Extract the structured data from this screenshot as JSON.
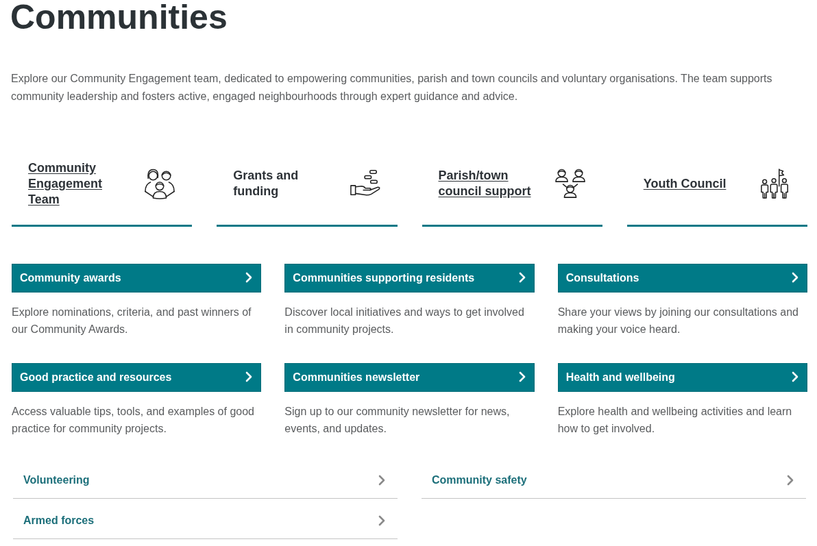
{
  "title": "Communities",
  "intro": "Explore our Community Engagement team, dedicated to empowering communities, parish and town councils and voluntary organisations. The team supports community leadership and fosters active, engaged neighbourhoods through expert guidance and advice.",
  "feature_cards": [
    {
      "title": "Community Engagement Team",
      "underlined": true
    },
    {
      "title": "Grants and funding",
      "underlined": false
    },
    {
      "title": "Parish/town council support",
      "underlined": true
    },
    {
      "title": "Youth Council",
      "underlined": true
    }
  ],
  "sections": [
    {
      "label": "Community awards",
      "description": "Explore nominations, criteria, and past winners of our Community Awards."
    },
    {
      "label": "Communities supporting residents",
      "description": "Discover local initiatives and ways to get involved in community projects."
    },
    {
      "label": "Consultations",
      "description": "Share your views by joining our consultations and making your voice heard."
    },
    {
      "label": "Good practice and resources",
      "description": "Access valuable tips, tools, and examples of good practice for community projects."
    },
    {
      "label": "Communities newsletter",
      "description": "Sign up to our community newsletter for news, events, and updates."
    },
    {
      "label": "Health and wellbeing",
      "description": "Explore health and wellbeing activities and learn how to get involved."
    }
  ],
  "quick_links": [
    "Volunteering",
    "Community safety",
    "Armed forces"
  ]
}
